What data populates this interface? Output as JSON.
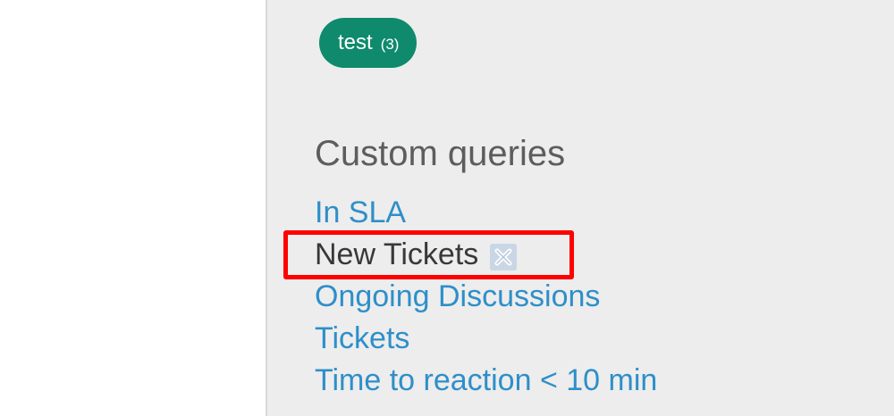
{
  "tag": {
    "name": "test",
    "count": "(3)",
    "color": "#0f8a6c"
  },
  "custom_queries": {
    "title": "Custom queries",
    "items": [
      {
        "label": "In SLA",
        "state": "link"
      },
      {
        "label": "New Tickets",
        "state": "current",
        "action_icon": "remove-icon"
      },
      {
        "label": "Ongoing Discussions",
        "state": "link"
      },
      {
        "label": "Tickets",
        "state": "link"
      },
      {
        "label": "Time to reaction < 10 min",
        "state": "link"
      }
    ]
  },
  "colors": {
    "link": "#2e8fc9",
    "current_item": "#383838",
    "sidebar_background": "#ededed",
    "highlight": "#ff0000"
  }
}
